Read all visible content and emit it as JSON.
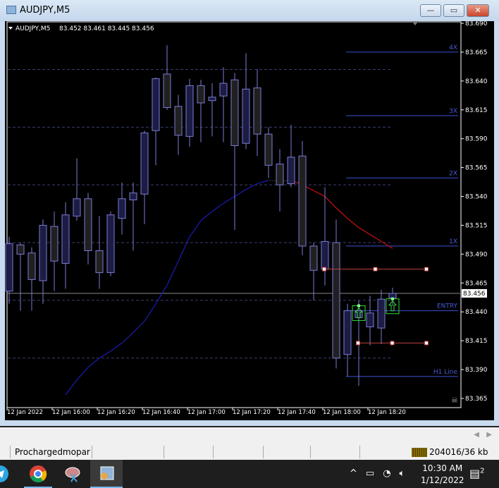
{
  "window": {
    "title": "AUDJPY,M5",
    "minimize": "—",
    "maximize": "▭",
    "close": "✕"
  },
  "chart_data": {
    "type": "candlestick",
    "symbol_label": "AUDJPY,M5",
    "ohlc_label": "83.452 83.461 83.445 83.456",
    "ylim": [
      83.365,
      83.69
    ],
    "y_ticks": [
      "83.690",
      "83.665",
      "83.640",
      "83.615",
      "83.590",
      "83.565",
      "83.540",
      "83.515",
      "83.490",
      "83.465",
      "83.440",
      "83.415",
      "83.390",
      "83.365"
    ],
    "bid": 83.456,
    "bid_label": "83.456",
    "x_ticks": [
      {
        "i": 0,
        "label": "12 Jan 2022"
      },
      {
        "i": 4,
        "label": "12 Jan 16:00"
      },
      {
        "i": 8,
        "label": "12 Jan 16:20"
      },
      {
        "i": 12,
        "label": "12 Jan 16:40"
      },
      {
        "i": 16,
        "label": "12 Jan 17:00"
      },
      {
        "i": 20,
        "label": "12 Jan 17:20"
      },
      {
        "i": 24,
        "label": "12 Jan 17:40"
      },
      {
        "i": 28,
        "label": "12 Jan 18:00"
      },
      {
        "i": 32,
        "label": "12 Jan 18:20"
      }
    ],
    "candles": [
      [
        83.458,
        83.505,
        83.447,
        83.499
      ],
      [
        83.498,
        83.5,
        83.441,
        83.49
      ],
      [
        83.491,
        83.496,
        83.441,
        83.468
      ],
      [
        83.467,
        83.52,
        83.447,
        83.515
      ],
      [
        83.514,
        83.527,
        83.458,
        83.484
      ],
      [
        83.482,
        83.535,
        83.46,
        83.524
      ],
      [
        83.523,
        83.573,
        83.519,
        83.538
      ],
      [
        83.538,
        83.543,
        83.481,
        83.493
      ],
      [
        83.493,
        83.523,
        83.46,
        83.474
      ],
      [
        83.474,
        83.527,
        83.471,
        83.524
      ],
      [
        83.521,
        83.552,
        83.507,
        83.538
      ],
      [
        83.537,
        83.552,
        83.493,
        83.543
      ],
      [
        83.542,
        83.597,
        83.516,
        83.595
      ],
      [
        83.597,
        83.643,
        83.567,
        83.642
      ],
      [
        83.646,
        83.671,
        83.615,
        83.617
      ],
      [
        83.618,
        83.628,
        83.576,
        83.593
      ],
      [
        83.592,
        83.642,
        83.583,
        83.636
      ],
      [
        83.636,
        83.641,
        83.587,
        83.621
      ],
      [
        83.623,
        83.638,
        83.592,
        83.626
      ],
      [
        83.627,
        83.652,
        83.587,
        83.638
      ],
      [
        83.641,
        83.647,
        83.511,
        83.584
      ],
      [
        83.586,
        83.664,
        83.581,
        83.633
      ],
      [
        83.634,
        83.65,
        83.575,
        83.594
      ],
      [
        83.594,
        83.6,
        83.556,
        83.567
      ],
      [
        83.568,
        83.581,
        83.527,
        83.55
      ],
      [
        83.551,
        83.602,
        83.548,
        83.574
      ],
      [
        83.575,
        83.588,
        83.489,
        83.497
      ],
      [
        83.497,
        83.5,
        83.45,
        83.476
      ],
      [
        83.477,
        83.548,
        83.463,
        83.501
      ],
      [
        83.5,
        83.52,
        83.391,
        83.4
      ],
      [
        83.403,
        83.447,
        83.384,
        83.441
      ],
      [
        83.435,
        83.45,
        83.376,
        83.441
      ],
      [
        83.427,
        83.454,
        83.411,
        83.439
      ],
      [
        83.426,
        83.459,
        83.412,
        83.451
      ],
      [
        83.452,
        83.461,
        83.445,
        83.456
      ]
    ],
    "moving_average": {
      "start_index": 5,
      "values": [
        83.368,
        83.381,
        83.392,
        83.4,
        83.406,
        83.413,
        83.422,
        83.432,
        83.447,
        83.463,
        83.484,
        83.505,
        83.519,
        83.527,
        83.534,
        83.54,
        83.546,
        83.551,
        83.554,
        83.553,
        83.554,
        83.55,
        83.545,
        83.54,
        83.53,
        83.521,
        83.513,
        83.507,
        83.501,
        83.495
      ],
      "colors": {
        "rising": "#1a1aa8",
        "flat": "#222222",
        "falling": "#c01010"
      },
      "rising_until": 23,
      "falling_from": 25
    },
    "grid_levels": [
      83.65,
      83.6,
      83.55,
      83.5,
      83.45,
      83.4
    ],
    "levels": [
      {
        "label": "4X",
        "price": 83.665
      },
      {
        "label": "3X",
        "price": 83.61
      },
      {
        "label": "2X",
        "price": 83.556
      },
      {
        "label": "1X",
        "price": 83.497
      },
      {
        "label": "ENTRY",
        "price": 83.441
      },
      {
        "label": "H1 Line",
        "price": 83.384
      }
    ],
    "red_lines": [
      {
        "price": 83.477,
        "from": 28,
        "to": 37
      },
      {
        "price": 83.413,
        "from": 31,
        "to": 37
      }
    ],
    "buy_arrows": [
      {
        "i": 31,
        "price": 83.441
      },
      {
        "i": 34,
        "price": 83.447
      }
    ],
    "colors": {
      "bull_body": "#1c1c44",
      "bear_body": "#202020",
      "candle_line": "#7b7bd6",
      "level": "#3d4fd0",
      "red_line": "#c04040",
      "arrow": "#33dd33",
      "grid": "#3a3f70"
    }
  },
  "status": {
    "profile": "Prochargedmopar",
    "connection": "204016/36 kb"
  },
  "taskbar": {
    "time": "10:30 AM",
    "date": "1/12/2022",
    "notifications": "2"
  }
}
